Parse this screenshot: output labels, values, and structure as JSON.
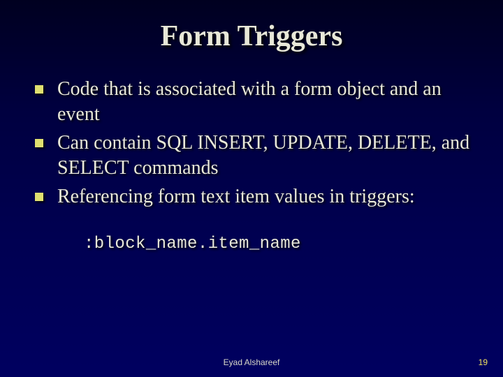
{
  "slide": {
    "title": "Form Triggers",
    "bullets": [
      "Code that is associated with a form object and an event",
      "Can contain SQL INSERT, UPDATE, DELETE, and SELECT commands",
      "Referencing form text item values in triggers:"
    ],
    "code_reference": ":block_name.item_name",
    "footer": {
      "author": "Eyad Alshareef",
      "page_number": "19"
    }
  }
}
